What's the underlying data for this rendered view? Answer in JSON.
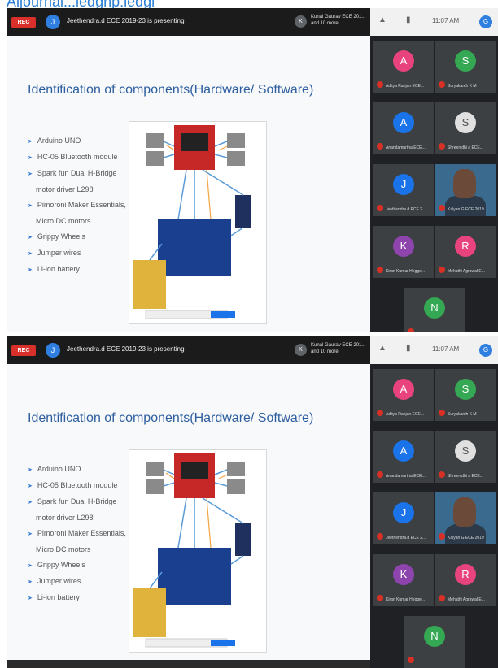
{
  "page_header": "Aljournal...ledgnp:ledgl",
  "shots": [
    {
      "rec_label": "REC",
      "presenter_avatar": "J",
      "presenting_text": "Jeethendra.d ECE 2019-23 is presenting",
      "others_avatar": "K",
      "others_text": "Kunal Gaurav ECE 201... and 10 more",
      "status_time": "11:07 AM",
      "account_initial": "G",
      "slide_title": "Identification of components(Hardware/ Software)",
      "bullets": [
        {
          "text": "Arduino UNO",
          "cont": false
        },
        {
          "text": "HC-05 Bluetooth module",
          "cont": false
        },
        {
          "text": "Spark fun Dual H-Bridge",
          "cont": false
        },
        {
          "text": "motor driver L298",
          "cont": true
        },
        {
          "text": "Pimoroni Maker Essentials,",
          "cont": false
        },
        {
          "text": "Micro DC motors",
          "cont": true
        },
        {
          "text": "Grippy Wheels",
          "cont": false
        },
        {
          "text": "Jumper wires",
          "cont": false
        },
        {
          "text": "Li-ion battery",
          "cont": false
        }
      ],
      "participants": [
        {
          "initial": "A",
          "name": "Aditya Ranjan ECE...",
          "color": "#e8437d"
        },
        {
          "initial": "S",
          "name": "Suryakanth K M",
          "color": "#34a853"
        },
        {
          "initial": "A",
          "name": "Anandamurtha ECE...",
          "color": "#1a73e8"
        },
        {
          "initial": "S",
          "name": "Shreenidhi a ECE...",
          "color": "#e0e0e0"
        },
        {
          "initial": "J",
          "name": "Jeethendra.d ECE 2...",
          "color": "#1a73e8"
        },
        {
          "initial": "",
          "name": "Kalyan G ECE 2019",
          "color": "#3a6b8f",
          "video": true
        },
        {
          "initial": "K",
          "name": "Kiran Kumar Hegge...",
          "color": "#8e44ad"
        },
        {
          "initial": "R",
          "name": "Mehathi Agrawal E...",
          "color": "#e8437d"
        },
        {
          "initial": "N",
          "name": "",
          "color": "#34a853"
        }
      ]
    },
    {
      "rec_label": "REC",
      "presenter_avatar": "J",
      "presenting_text": "Jeethendra.d ECE 2019-23 is presenting",
      "others_avatar": "K",
      "others_text": "Kunal Gaurav ECE 201... and 10 more",
      "status_time": "11:07 AM",
      "account_initial": "G",
      "slide_title": "Identification of components(Hardware/ Software)",
      "bullets": [
        {
          "text": "Arduino UNO",
          "cont": false
        },
        {
          "text": "HC-05 Bluetooth module",
          "cont": false
        },
        {
          "text": "Spark fun Dual H-Bridge",
          "cont": false
        },
        {
          "text": "motor driver L298",
          "cont": true
        },
        {
          "text": "Pimoroni Maker Essentials,",
          "cont": false
        },
        {
          "text": "Micro DC motors",
          "cont": true
        },
        {
          "text": "Grippy Wheels",
          "cont": false
        },
        {
          "text": "Jumper wires",
          "cont": false
        },
        {
          "text": "Li-ion battery",
          "cont": false
        }
      ],
      "participants": [
        {
          "initial": "A",
          "name": "Aditya Ranjan ECE...",
          "color": "#e8437d"
        },
        {
          "initial": "S",
          "name": "Suryakanth K M",
          "color": "#34a853"
        },
        {
          "initial": "A",
          "name": "Anandamurtha ECE...",
          "color": "#1a73e8"
        },
        {
          "initial": "S",
          "name": "Shreenidhi a ECE...",
          "color": "#e0e0e0"
        },
        {
          "initial": "J",
          "name": "Jeethendra.d ECE 2...",
          "color": "#1a73e8"
        },
        {
          "initial": "",
          "name": "Kalyan G ECE 2019",
          "color": "#3a6b8f",
          "video": true
        },
        {
          "initial": "K",
          "name": "Kiran Kumar Hegge...",
          "color": "#8e44ad"
        },
        {
          "initial": "R",
          "name": "Mehathi Agrawal E...",
          "color": "#e8437d"
        },
        {
          "initial": "N",
          "name": "",
          "color": "#34a853"
        }
      ]
    }
  ]
}
